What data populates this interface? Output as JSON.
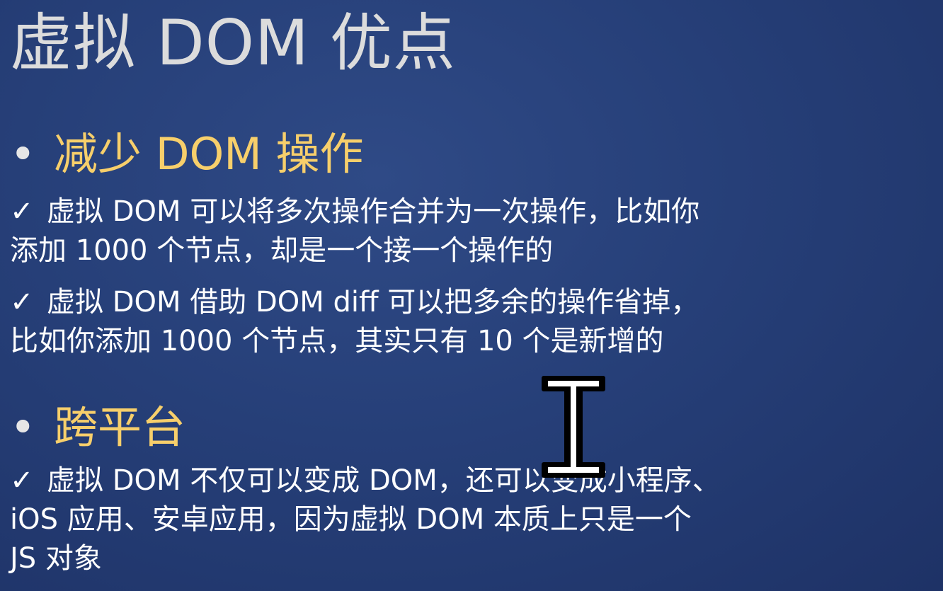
{
  "slide": {
    "title": "虚拟 DOM 优点",
    "sections": [
      {
        "bullet": "•",
        "heading": "减少 DOM 操作",
        "points": [
          {
            "check": "✓",
            "lines": [
              "虚拟 DOM 可以将多次操作合并为一次操作，比如你",
              "添加 1000 个节点，却是一个接一个操作的"
            ]
          },
          {
            "check": "✓",
            "lines": [
              "虚拟 DOM 借助 DOM diff 可以把多余的操作省掉，",
              "比如你添加 1000 个节点，其实只有 10 个是新增的"
            ]
          }
        ]
      },
      {
        "bullet": "•",
        "heading": "跨平台",
        "points": [
          {
            "check": "✓",
            "lines": [
              "虚拟 DOM 不仅可以变成 DOM，还可以变成小程序、",
              "iOS 应用、安卓应用，因为虚拟 DOM 本质上只是一个",
              "JS 对象"
            ]
          }
        ]
      }
    ]
  },
  "cursor": {
    "icon": "text-i-beam-cursor-icon"
  },
  "colors": {
    "background": "#263f78",
    "title": "#dcdcdc",
    "heading": "#f7cf6b",
    "body": "#ffffff"
  }
}
